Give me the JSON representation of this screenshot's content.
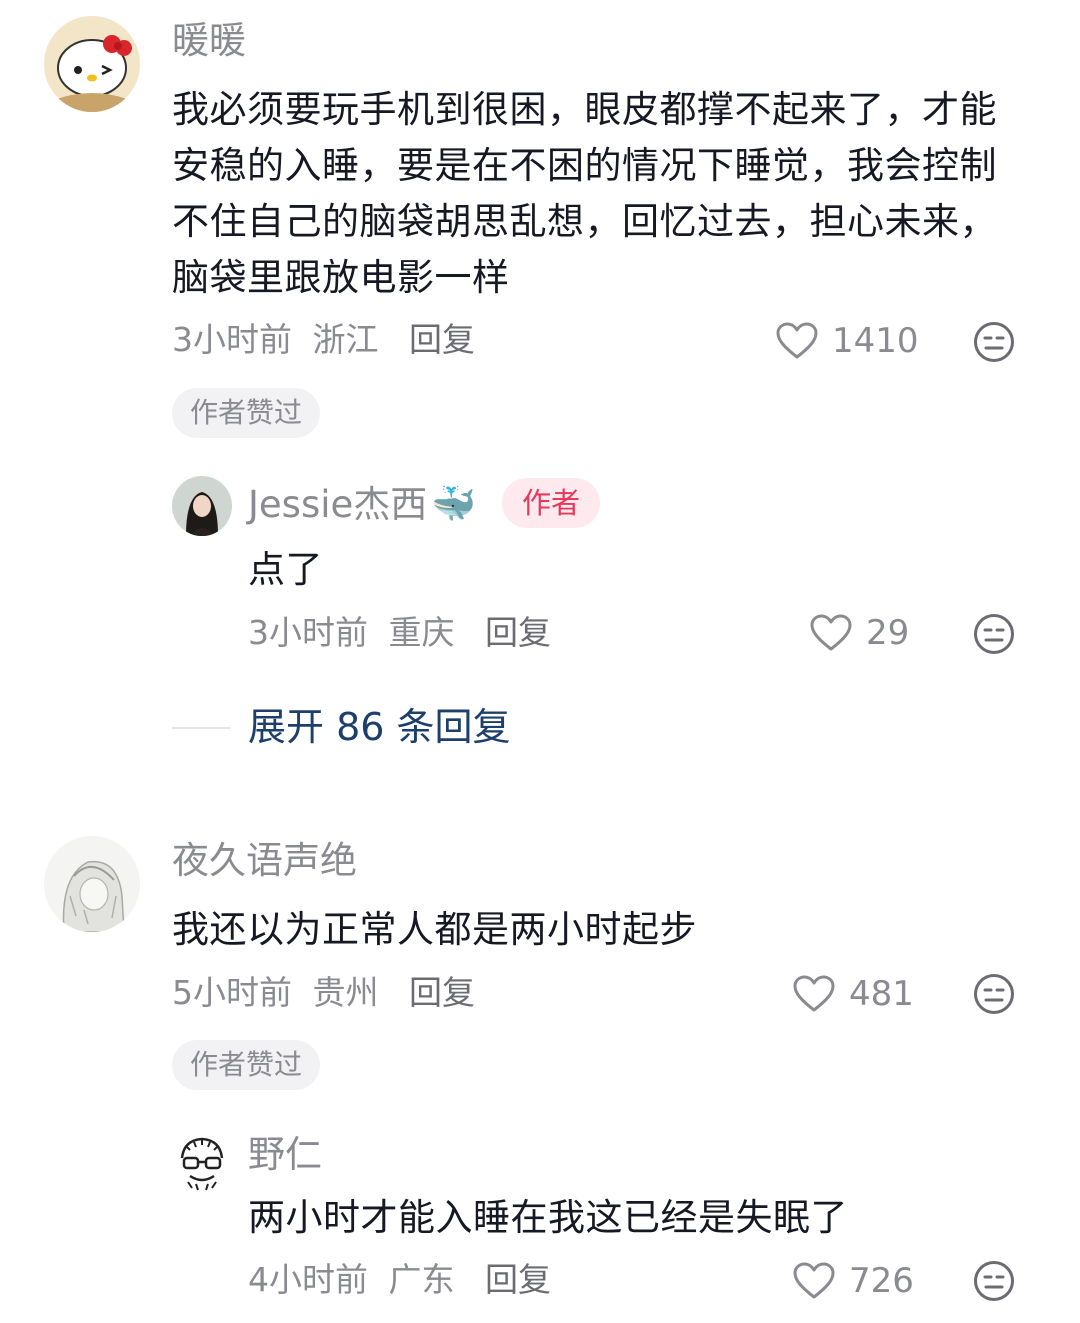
{
  "comments": [
    {
      "username": "暖暖",
      "avatar": "hello-kitty-avatar",
      "content": "我必须要玩手机到很困，眼皮都撑不起来了，才能安稳的入睡，要是在不困的情况下睡觉，我会控制不住自己的脑袋胡思乱想，回忆过去，担心未来，脑袋里跟放电影一样",
      "time": "3小时前",
      "location": "浙江",
      "reply_label": "回复",
      "likes": "1410",
      "badge": "作者赞过",
      "replies": [
        {
          "username": "Jessie杰西",
          "emoji": "🐳",
          "author_tag": "作者",
          "content": "点了",
          "time": "3小时前",
          "location": "重庆",
          "reply_label": "回复",
          "likes": "29"
        }
      ],
      "expand_label": "展开 86 条回复"
    },
    {
      "username": "夜久语声绝",
      "avatar": "sketch-portrait-avatar",
      "content": "我还以为正常人都是两小时起步",
      "time": "5小时前",
      "location": "贵州",
      "reply_label": "回复",
      "likes": "481",
      "badge": "作者赞过",
      "replies": [
        {
          "username": "野仁",
          "content": "两小时才能入睡在我这已经是失眠了",
          "time": "4小时前",
          "location": "广东",
          "reply_label": "回复",
          "likes": "726"
        }
      ]
    }
  ],
  "colors": {
    "name": "#8a8b90",
    "text": "#161823",
    "author_tag": "#e8375b",
    "expand": "#1d3f6e"
  }
}
